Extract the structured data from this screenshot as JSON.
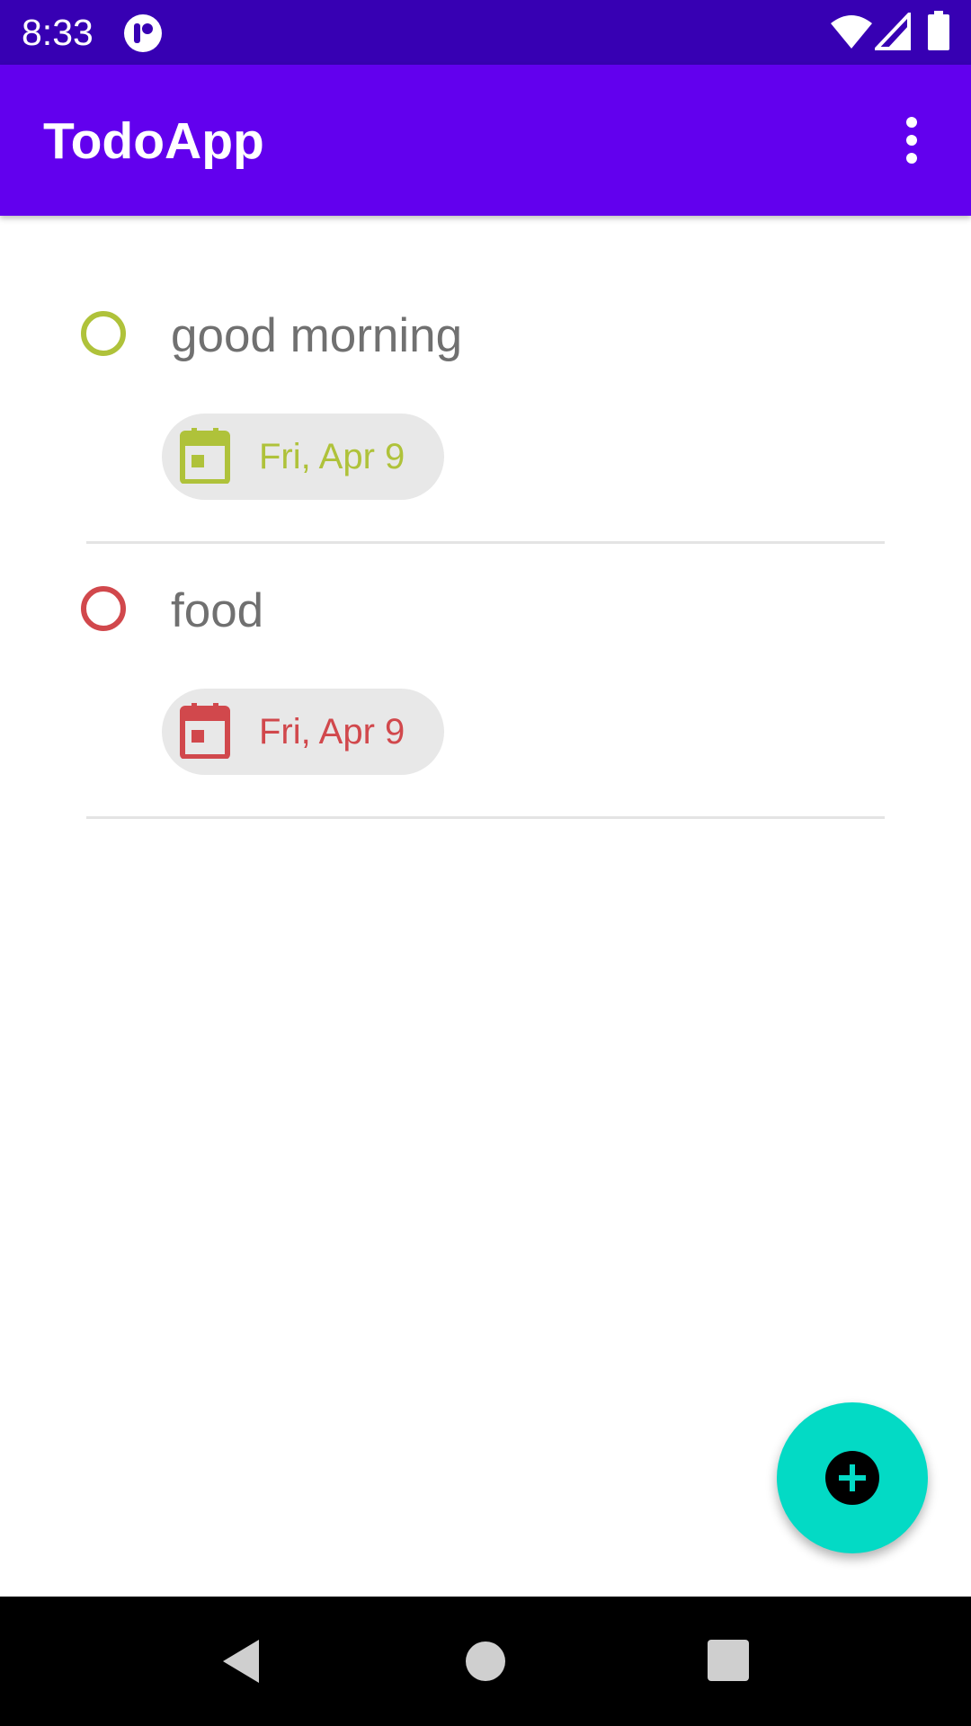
{
  "status_bar": {
    "time": "8:33",
    "icons": [
      "app-notification-icon",
      "wifi-icon",
      "signal-icon",
      "battery-icon"
    ]
  },
  "app_bar": {
    "title": "TodoApp",
    "menu_icon": "more-vert-icon",
    "background": "#6200ee"
  },
  "todos": [
    {
      "title": "good morning",
      "date": "Fri, Apr 9",
      "color": "#afc23a",
      "completed": false
    },
    {
      "title": "food",
      "date": "Fri, Apr 9",
      "color": "#d1484c",
      "completed": false
    }
  ],
  "fab": {
    "icon": "add-icon",
    "color": "#03dac5"
  },
  "nav_bar": {
    "icons": [
      "back-icon",
      "home-icon",
      "recents-icon"
    ]
  },
  "colors": {
    "status_bar": "#3700b3",
    "text_secondary": "#707070",
    "chip_bg": "#e8e8e8"
  }
}
